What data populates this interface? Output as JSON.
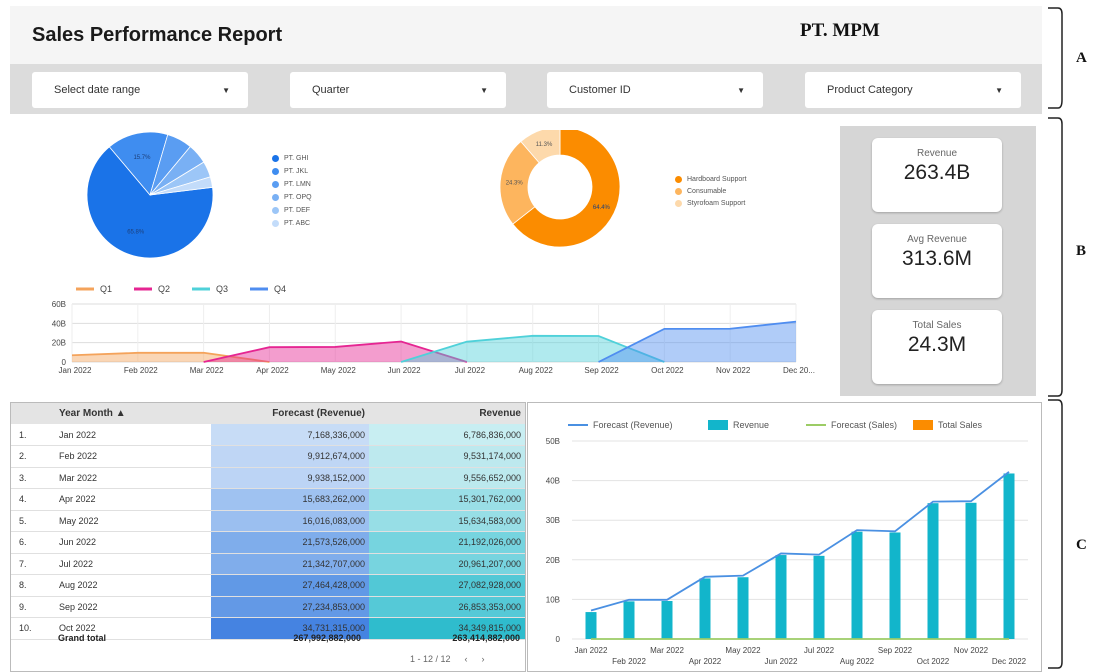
{
  "header": {
    "title": "Sales Performance Report",
    "company": "PT. MPM"
  },
  "filters": [
    {
      "label": "Select date range"
    },
    {
      "label": "Quarter"
    },
    {
      "label": "Customer ID"
    },
    {
      "label": "Product Category"
    }
  ],
  "kpis": [
    {
      "label": "Revenue",
      "value": "263.4B"
    },
    {
      "label": "Avg Revenue",
      "value": "313.6M"
    },
    {
      "label": "Total Sales",
      "value": "24.3M"
    }
  ],
  "section_labels": {
    "a": "A",
    "b": "B",
    "c": "C"
  },
  "colors": {
    "accent_blue": "#1a73e8",
    "orange": "#fb8c00",
    "teal": "#12b5cb",
    "pink": "#e52592"
  },
  "table": {
    "headers": {
      "month": "Year Month",
      "forecast": "Forecast (Revenue)",
      "revenue": "Revenue",
      "sort_icon": "sort-up-icon"
    },
    "rows": [
      {
        "idx": "1.",
        "month": "Jan 2022",
        "forecast": "7,168,336,000",
        "revenue": "6,786,836,000"
      },
      {
        "idx": "2.",
        "month": "Feb 2022",
        "forecast": "9,912,674,000",
        "revenue": "9,531,174,000"
      },
      {
        "idx": "3.",
        "month": "Mar 2022",
        "forecast": "9,938,152,000",
        "revenue": "9,556,652,000"
      },
      {
        "idx": "4.",
        "month": "Apr 2022",
        "forecast": "15,683,262,000",
        "revenue": "15,301,762,000"
      },
      {
        "idx": "5.",
        "month": "May 2022",
        "forecast": "16,016,083,000",
        "revenue": "15,634,583,000"
      },
      {
        "idx": "6.",
        "month": "Jun 2022",
        "forecast": "21,573,526,000",
        "revenue": "21,192,026,000"
      },
      {
        "idx": "7.",
        "month": "Jul 2022",
        "forecast": "21,342,707,000",
        "revenue": "20,961,207,000"
      },
      {
        "idx": "8.",
        "month": "Aug 2022",
        "forecast": "27,464,428,000",
        "revenue": "27,082,928,000"
      },
      {
        "idx": "9.",
        "month": "Sep 2022",
        "forecast": "27,234,853,000",
        "revenue": "26,853,353,000"
      },
      {
        "idx": "10.",
        "month": "Oct 2022",
        "forecast": "34,731,315,000",
        "revenue": "34,349,815,000"
      }
    ],
    "grand_total": {
      "label": "Grand total",
      "forecast": "267,992,882,000",
      "revenue": "263,414,882,000"
    },
    "pager": {
      "range": "1 - 12 / 12",
      "prev": "‹",
      "next": "›"
    }
  },
  "chart_data": [
    {
      "type": "pie",
      "labels": [
        "PT. GHI",
        "PT. JKL",
        "PT. LMN",
        "PT. OPQ",
        "PT. DEF",
        "PT. ABC"
      ],
      "values": [
        65.8,
        15.7,
        6.5,
        5.2,
        4.1,
        2.7
      ],
      "data_labels": [
        "65.8%",
        "15.7%",
        "",
        "",
        "",
        ""
      ],
      "colors": [
        "#1a73e8",
        "#3f8df0",
        "#5a9df2",
        "#79b0f4",
        "#9cc6f7",
        "#c3dcfa"
      ],
      "legend_position": "right"
    },
    {
      "type": "pie",
      "donut": true,
      "labels": [
        "Hardboard Support",
        "Consumable",
        "Styrofoam Support"
      ],
      "values": [
        64.4,
        24.3,
        11.3
      ],
      "data_labels": [
        "64.4%",
        "24.3%",
        "11.3%"
      ],
      "colors": [
        "#fb8c00",
        "#fdb55e",
        "#fdd9ab"
      ],
      "legend_position": "right"
    },
    {
      "type": "area",
      "categories": [
        "Jan 2022",
        "Feb 2022",
        "Mar 2022",
        "Apr 2022",
        "May 2022",
        "Jun 2022",
        "Jul 2022",
        "Aug 2022",
        "Sep 2022",
        "Oct 2022",
        "Nov 2022",
        "Dec 20..."
      ],
      "series": [
        {
          "name": "Q1",
          "color": "#f4a35b",
          "values": [
            7,
            9.5,
            9.6,
            0,
            null,
            null,
            null,
            null,
            null,
            null,
            null,
            null
          ]
        },
        {
          "name": "Q2",
          "color": "#e52592",
          "values": [
            null,
            null,
            0,
            15.3,
            15.6,
            21.2,
            0,
            null,
            null,
            null,
            null,
            null
          ]
        },
        {
          "name": "Q3",
          "color": "#4fd1d9",
          "values": [
            null,
            null,
            null,
            null,
            null,
            0,
            21,
            27.1,
            26.9,
            0,
            null,
            null
          ]
        },
        {
          "name": "Q4",
          "color": "#4f8df0",
          "values": [
            null,
            null,
            null,
            null,
            null,
            null,
            null,
            null,
            0,
            34.3,
            34.4,
            41.8
          ]
        }
      ],
      "yticks": [
        "0",
        "20B",
        "40B",
        "60B"
      ],
      "ylim": [
        0,
        60
      ],
      "grid": true,
      "legend_position": "top-left"
    },
    {
      "type": "bar",
      "categories": [
        "Jan 2022",
        "Feb 2022",
        "Mar 2022",
        "Apr 2022",
        "May 2022",
        "Jun 2022",
        "Jul 2022",
        "Aug 2022",
        "Sep 2022",
        "Oct 2022",
        "Nov 2022",
        "Dec 2022"
      ],
      "series": [
        {
          "name": "Forecast (Revenue)",
          "kind": "line",
          "color": "#4a90e2",
          "values": [
            7.2,
            9.9,
            9.9,
            15.7,
            16.0,
            21.6,
            21.3,
            27.5,
            27.2,
            34.7,
            34.8,
            42.2
          ]
        },
        {
          "name": "Revenue",
          "kind": "bar",
          "color": "#12b5cb",
          "values": [
            6.8,
            9.5,
            9.6,
            15.3,
            15.6,
            21.2,
            21.0,
            27.1,
            26.9,
            34.3,
            34.4,
            41.8
          ]
        },
        {
          "name": "Forecast (Sales)",
          "kind": "line",
          "color": "#9ccc65",
          "values": [
            0,
            0,
            0,
            0,
            0,
            0,
            0,
            0,
            0,
            0,
            0,
            0
          ]
        },
        {
          "name": "Total Sales",
          "kind": "bar",
          "color": "#fb8c00",
          "values": [
            0,
            0,
            0,
            0,
            0,
            0,
            0,
            0,
            0,
            0,
            0,
            0
          ]
        }
      ],
      "yticks": [
        "0",
        "10B",
        "20B",
        "30B",
        "40B",
        "50B"
      ],
      "ylim": [
        0,
        50
      ],
      "grid": true,
      "legend_position": "top"
    }
  ]
}
